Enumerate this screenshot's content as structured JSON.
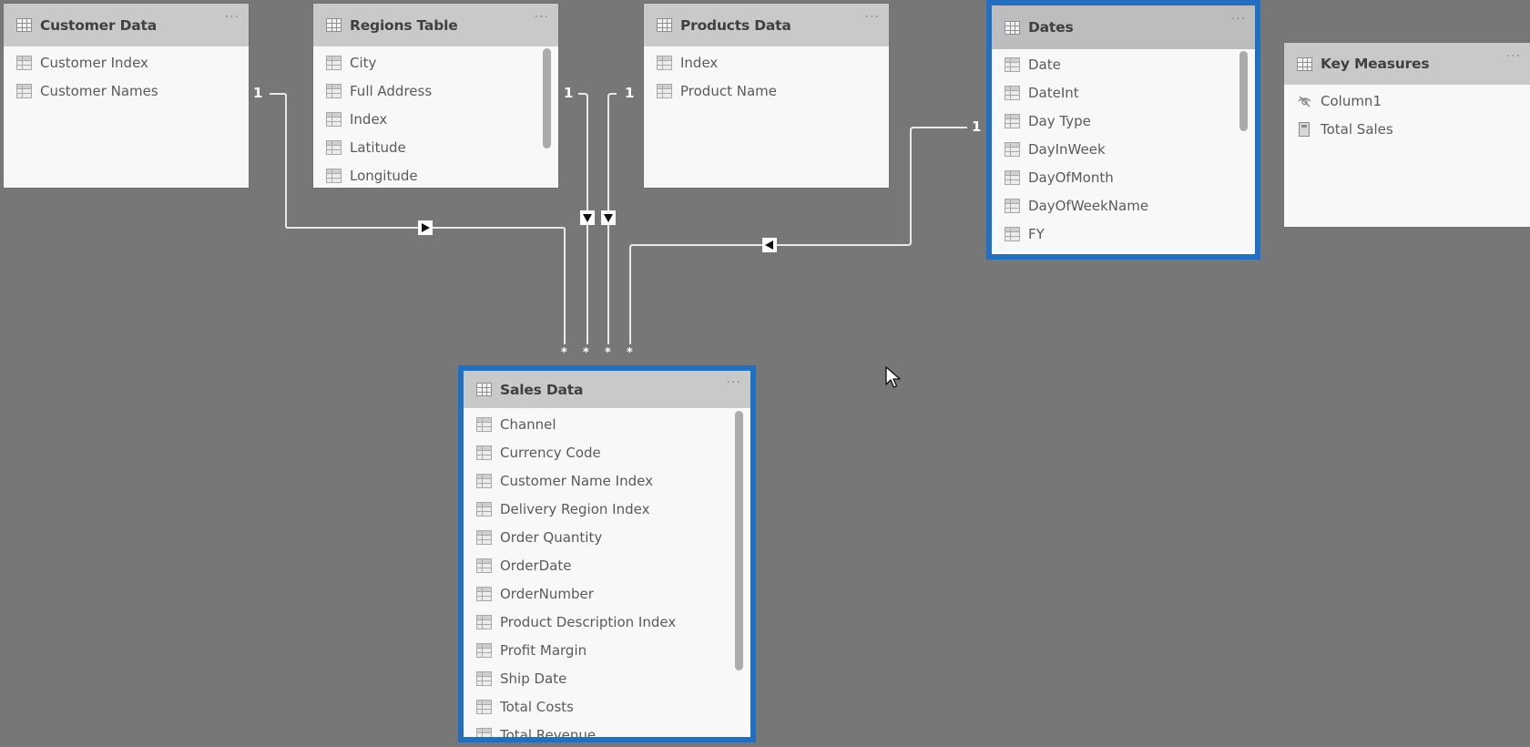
{
  "tables": {
    "customer": {
      "title": "Customer Data",
      "more": "···",
      "columns": [
        "Customer Index",
        "Customer Names"
      ]
    },
    "regions": {
      "title": "Regions Table",
      "more": "···",
      "columns": [
        "City",
        "Full Address",
        "Index",
        "Latitude",
        "Longitude"
      ]
    },
    "products": {
      "title": "Products Data",
      "more": "···",
      "columns": [
        "Index",
        "Product Name"
      ]
    },
    "dates": {
      "title": "Dates",
      "more": "···",
      "selected": true,
      "columns": [
        "Date",
        "DateInt",
        "Day Type",
        "DayInWeek",
        "DayOfMonth",
        "DayOfWeekName",
        "FY"
      ]
    },
    "key_measures": {
      "title": "Key Measures",
      "more": "···",
      "columns": [
        {
          "label": "Column1",
          "icon": "hidden-column-icon"
        },
        {
          "label": "Total Sales",
          "icon": "measure-calculator-icon"
        }
      ]
    },
    "sales": {
      "title": "Sales Data",
      "more": "···",
      "selected": true,
      "columns": [
        "Channel",
        "Currency Code",
        "Customer Name Index",
        "Delivery Region Index",
        "Order Quantity",
        "OrderDate",
        "OrderNumber",
        "Product Description Index",
        "Profit Margin",
        "Ship Date",
        "Total Costs",
        "Total Revenue"
      ]
    }
  },
  "relationships": [
    {
      "from": "Customer Data",
      "to": "Sales Data",
      "one_label": "1",
      "many_label": "*",
      "direction": "right"
    },
    {
      "from": "Regions Table",
      "to": "Sales Data",
      "one_label": "1",
      "many_label": "*",
      "direction": "down"
    },
    {
      "from": "Products Data",
      "to": "Sales Data",
      "one_label": "1",
      "many_label": "*",
      "direction": "down"
    },
    {
      "from": "Dates",
      "to": "Sales Data",
      "one_label": "1",
      "many_label": "*",
      "direction": "left"
    }
  ],
  "colors": {
    "canvas": "#777777",
    "selection": "#1f6fc5",
    "header": "#c9c9c9",
    "card": "#f8f8f8"
  }
}
